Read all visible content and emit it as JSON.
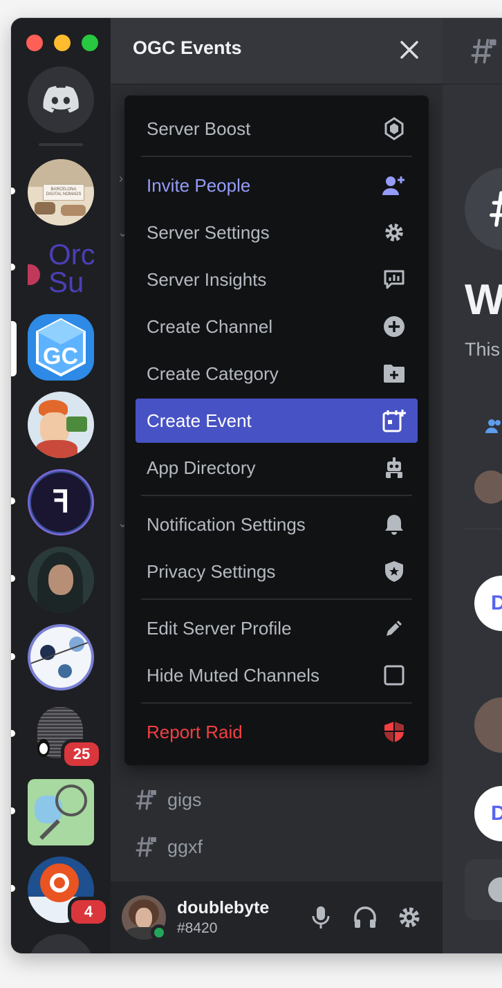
{
  "server": {
    "name": "OGC Events"
  },
  "menu": {
    "items": [
      {
        "label": "Server Boost",
        "icon": "boost-gem-icon"
      },
      {
        "label": "Invite People",
        "icon": "add-person-icon"
      },
      {
        "label": "Server Settings",
        "icon": "gear-icon"
      },
      {
        "label": "Server Insights",
        "icon": "insights-chart-icon"
      },
      {
        "label": "Create Channel",
        "icon": "plus-circle-icon"
      },
      {
        "label": "Create Category",
        "icon": "folder-plus-icon"
      },
      {
        "label": "Create Event",
        "icon": "calendar-plus-icon"
      },
      {
        "label": "App Directory",
        "icon": "robot-icon"
      },
      {
        "label": "Notification Settings",
        "icon": "bell-icon"
      },
      {
        "label": "Privacy Settings",
        "icon": "shield-star-icon"
      },
      {
        "label": "Edit Server Profile",
        "icon": "pencil-icon"
      },
      {
        "label": "Hide Muted Channels",
        "icon": "checkbox-empty-icon"
      },
      {
        "label": "Report Raid",
        "icon": "raid-shield-icon"
      }
    ]
  },
  "channels": [
    {
      "name": "gigs"
    },
    {
      "name": "ggxf"
    }
  ],
  "servers": {
    "badges": {
      "linux": "25",
      "ubuntu": "4"
    },
    "barcelona_label": "BARCELONA DIGITAL NOMADS",
    "orca_text": "Orc Su"
  },
  "user": {
    "name": "doublebyte",
    "tag": "#8420"
  },
  "main": {
    "welcome": "W",
    "this_text": "This",
    "d_letter": "D"
  },
  "colors": {
    "accent": "#949cf7",
    "selected": "#4752c4",
    "danger": "#f23f42",
    "online": "#23a55a",
    "badge": "#da373c"
  }
}
